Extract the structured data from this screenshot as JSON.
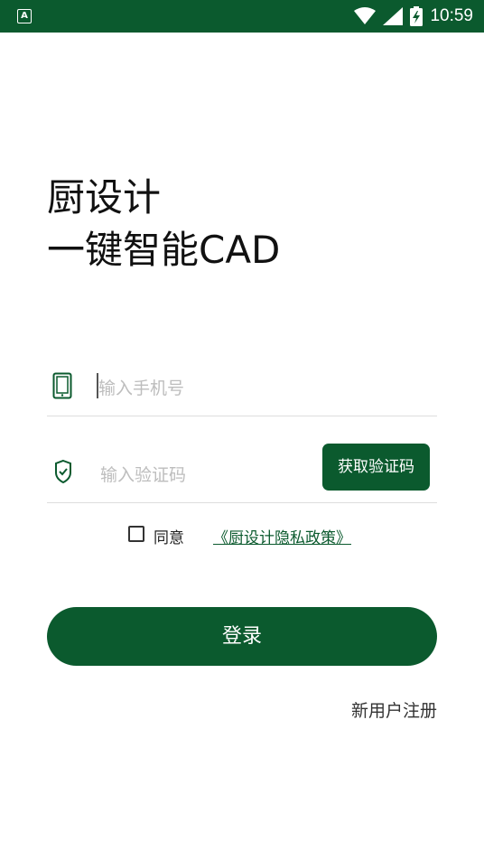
{
  "status_bar": {
    "app_icon_letter": "A",
    "time": "10:59"
  },
  "headline": {
    "line1": "厨设计",
    "line2": "一键智能CAD"
  },
  "phone_field": {
    "placeholder": "输入手机号"
  },
  "code_field": {
    "placeholder": "输入验证码",
    "get_code_label": "获取验证码"
  },
  "agreement": {
    "agree_label": "同意",
    "policy_link": "《厨设计隐私政策》",
    "checked": false
  },
  "login_button": "登录",
  "register_link": "新用户注册",
  "colors": {
    "brand": "#0b5a2e",
    "divider": "#dddddd",
    "placeholder": "#bdbdbd"
  }
}
